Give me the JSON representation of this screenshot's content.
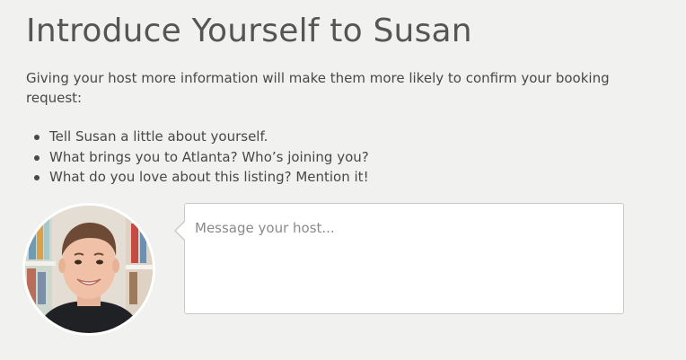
{
  "header": {
    "title": "Introduce Yourself to Susan"
  },
  "intro": {
    "text": "Giving your host more information will make them more likely to confirm your booking request:"
  },
  "tips": [
    "Tell Susan a little about yourself.",
    "What brings you to Atlanta? Who’s joining you?",
    "What do you love about this listing? Mention it!"
  ],
  "message": {
    "placeholder": "Message your host...",
    "value": ""
  },
  "avatar": {
    "icon": "user-avatar-photo"
  },
  "colors": {
    "background": "#f1f1f0",
    "text": "#484848",
    "title": "#555555",
    "input_border": "#c9c9c9"
  }
}
